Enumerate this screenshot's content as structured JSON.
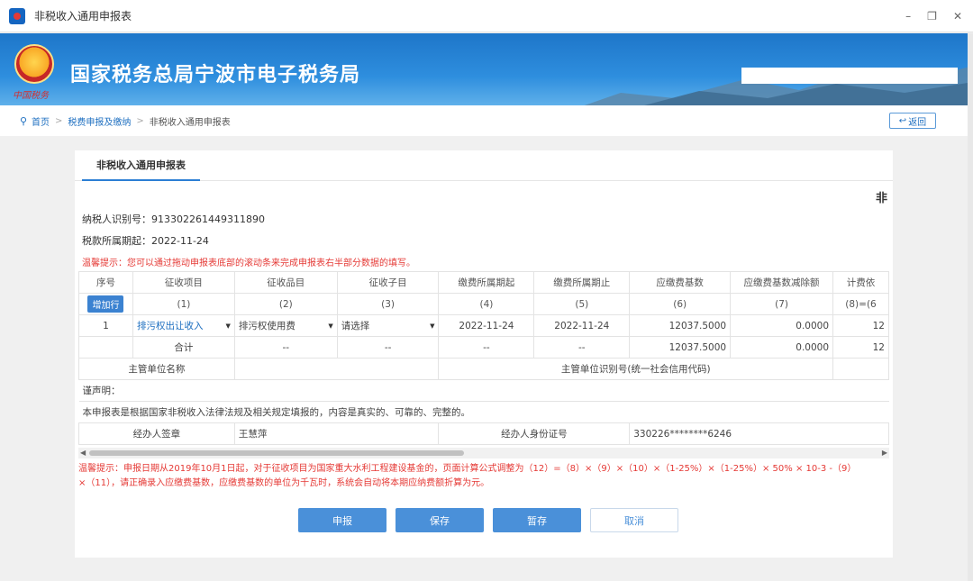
{
  "window": {
    "title": "非税收入通用申报表"
  },
  "banner": {
    "org_title": "国家税务总局宁波市电子税务局",
    "emblem_text": "中国税务"
  },
  "breadcrumb": {
    "items": [
      "首页",
      "税费申报及缴纳",
      "非税收入通用申报表"
    ],
    "back_label": "返回"
  },
  "tab": {
    "label": "非税收入通用申报表"
  },
  "form": {
    "head_char": "非",
    "taxpayer_id": "纳税人识别号：913302261449311890",
    "period_start": "税款所属期起：2022-11-24",
    "tip": "温馨提示：您可以通过拖动申报表底部的滚动条来完成申报表右半部分数据的填写。"
  },
  "table": {
    "headers": [
      "序号",
      "征收项目",
      "征收品目",
      "征收子目",
      "缴费所属期起",
      "缴费所属期止",
      "应缴费基数",
      "应缴费基数减除额",
      "计费依"
    ],
    "add_button": "增加行",
    "col_numbers": [
      "(1)",
      "(2)",
      "(3)",
      "(4)",
      "(5)",
      "(6)",
      "(7)",
      "(8)=(6"
    ],
    "row1": {
      "seq": "1",
      "project": "排污权出让收入",
      "item": "排污权使用费",
      "subitem": "请选择",
      "start": "2022-11-24",
      "end": "2022-11-24",
      "base": "12037.5000",
      "deduction": "0.0000",
      "calc": "12"
    },
    "total": {
      "label": "合计",
      "item": "--",
      "subitem": "--",
      "start": "--",
      "end": "--",
      "base": "12037.5000",
      "deduction": "0.0000",
      "calc": "12"
    },
    "dept_name_label": "主管单位名称",
    "dept_id_label": "主管单位识别号(统一社会信用代码)",
    "declaration_label": "谨声明：",
    "declaration_text": "本申报表是根据国家非税收入法律法规及相关规定填报的，内容是真实的、可靠的、完整的。",
    "agent_sign_label": "经办人签章",
    "agent_name": "王慧萍",
    "agent_id_label": "经办人身份证号",
    "agent_id": "330226********6246"
  },
  "warning2": {
    "line1": "温馨提示：申报日期从2019年10月1日起，对于征收项目为国家重大水利工程建设基金的，页面计算公式调整为（12）=（8）×（9）×（10）×（1-25%）×（1-25%）× 50% × 10-3 -（9）",
    "line2": "×（11），请正确录入应缴费基数，应缴费基数的单位为千瓦时，系统会自动将本期应纳费额折算为元。"
  },
  "buttons": {
    "submit": "申报",
    "save": "保存",
    "temp_save": "暂存",
    "cancel": "取消"
  }
}
